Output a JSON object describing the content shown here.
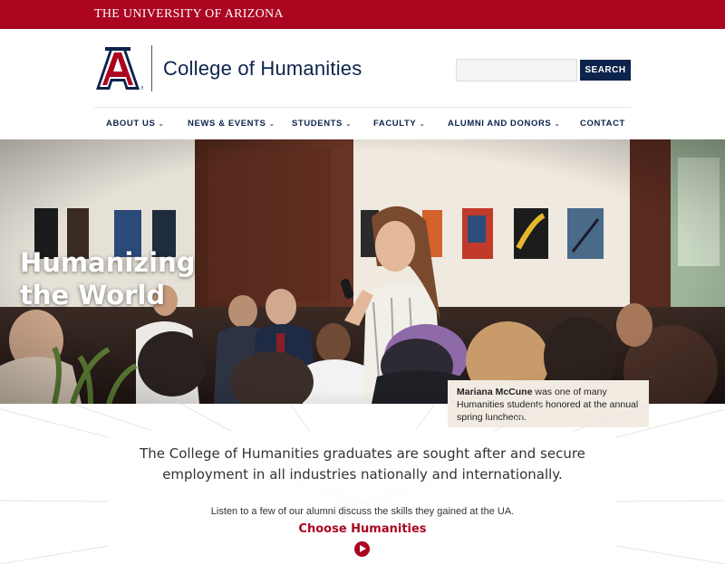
{
  "topbar": {
    "university": "THE UNIVERSITY OF ARIZONA"
  },
  "header": {
    "college_name": "College of Humanities",
    "search_placeholder": "",
    "search_button": "SEARCH"
  },
  "nav": [
    {
      "label": "ABOUT US",
      "dropdown": true
    },
    {
      "label": "NEWS & EVENTS",
      "dropdown": true
    },
    {
      "label": "STUDENTS",
      "dropdown": true
    },
    {
      "label": "FACULTY",
      "dropdown": true
    },
    {
      "label": "ALUMNI AND DONORS",
      "dropdown": true
    },
    {
      "label": "CONTACT",
      "dropdown": false
    }
  ],
  "hero": {
    "headline_line1": "Humanizing",
    "headline_line2": "the World",
    "caption_name": "Mariana McCune",
    "caption_rest": " was one of many Humanities students honored at the annual spring luncheon."
  },
  "content": {
    "lead_line1": "The College of Humanities graduates are sought after and secure",
    "lead_line2": "employment in all industries nationally and internationally.",
    "sub": "Listen to a few of our alumni discuss the skills they gained at the UA.",
    "cta": "Choose Humanities"
  },
  "colors": {
    "brand_red": "#ab0520",
    "brand_navy": "#0c234b",
    "caption_bg": "#f2ebe2"
  },
  "icons": {
    "play": "play-circle-icon",
    "dropdown": "chevron-down-icon",
    "logo": "block-a-logo"
  }
}
